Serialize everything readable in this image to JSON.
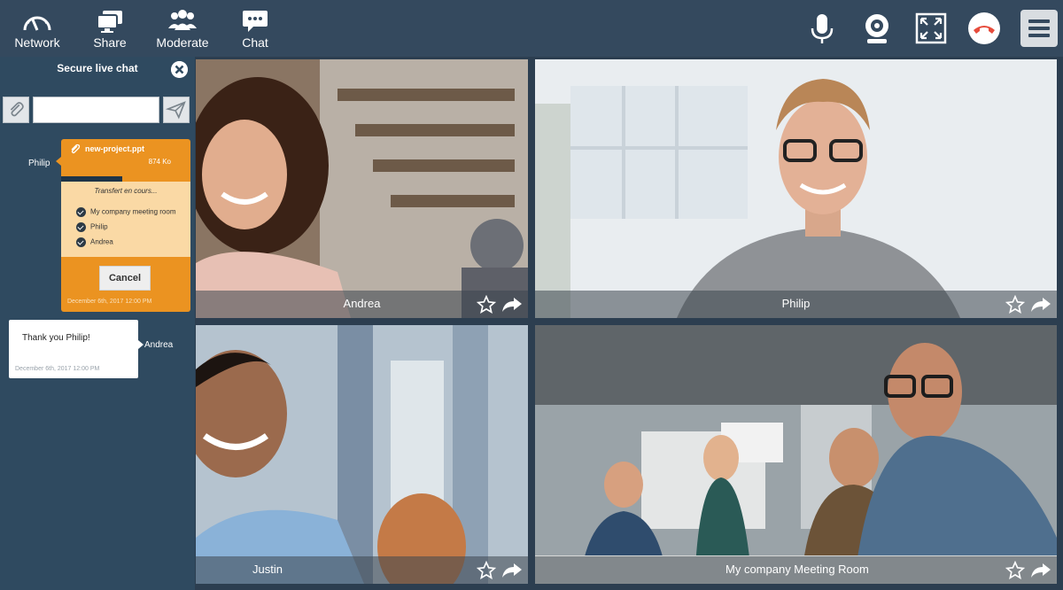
{
  "toolbar": {
    "network": "Network",
    "share": "Share",
    "moderate": "Moderate",
    "chat": "Chat",
    "right_icons": [
      "microphone-icon",
      "webcam-icon",
      "fullscreen-icon",
      "hang-up-icon",
      "menu-icon"
    ]
  },
  "chat": {
    "title": "Secure live chat",
    "input_value": "",
    "messages": [
      {
        "sender": "Philip",
        "file_name": "new-project.ppt",
        "file_size": "874 Ko",
        "progress": 0.47,
        "status": "Transfert en cours...",
        "recipients": [
          "My company meeting room",
          "Philip",
          "Andrea"
        ],
        "cancel_label": "Cancel",
        "date": "December 6th, 2017 12:00 PM"
      },
      {
        "sender": "Andrea",
        "text": "Thank you Philip!",
        "date": "December 6th, 2017 12:00 PM"
      }
    ]
  },
  "tiles": [
    {
      "name": "Andrea"
    },
    {
      "name": "Philip"
    },
    {
      "name": "Justin"
    },
    {
      "name": "My company Meeting Room"
    }
  ],
  "colors": {
    "toolbar_bg": "#34495e",
    "sidebar_bg": "#2f4a60",
    "file_card": "#eb9321",
    "hangup": "#e74c3c"
  }
}
